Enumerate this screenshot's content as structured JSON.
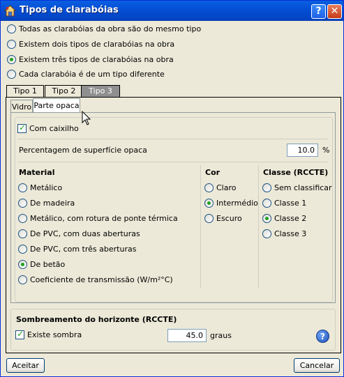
{
  "window": {
    "title": "Tipos de clarabóias",
    "help_btn": "?",
    "close_btn": "✕"
  },
  "type_options": [
    {
      "label": "Todas as clarabóias da obra são do mesmo tipo",
      "checked": false
    },
    {
      "label": "Existem dois tipos de clarabóias na obra",
      "checked": false
    },
    {
      "label": "Existem três tipos de clarabóias na obra",
      "checked": true
    },
    {
      "label": "Cada clarabóia é de um tipo diferente",
      "checked": false
    }
  ],
  "tabs": [
    {
      "label": "Tipo 1",
      "active": false
    },
    {
      "label": "Tipo 2",
      "active": false
    },
    {
      "label": "Tipo 3",
      "active": true
    }
  ],
  "subtabs": [
    {
      "label": "Vidro",
      "active": false
    },
    {
      "label": "Parte opaca",
      "active": true
    }
  ],
  "opaque": {
    "frame_label": "Com caixilho",
    "frame_checked": true,
    "percent_label": "Percentagem de superfície opaca",
    "percent_value": "10.0",
    "percent_unit": "%"
  },
  "material": {
    "header": "Material",
    "options": [
      {
        "label": "Metálico",
        "checked": false
      },
      {
        "label": "De madeira",
        "checked": false
      },
      {
        "label": "Metálico, com rotura de ponte térmica",
        "checked": false
      },
      {
        "label": "De PVC, com duas aberturas",
        "checked": false
      },
      {
        "label": "De PVC, com três aberturas",
        "checked": false
      },
      {
        "label": "De betão",
        "checked": true
      },
      {
        "label": "Coeficiente de transmissão (W/m²°C)",
        "checked": false
      }
    ]
  },
  "cor": {
    "header": "Cor",
    "options": [
      {
        "label": "Claro",
        "checked": false
      },
      {
        "label": "Intermédio",
        "checked": true
      },
      {
        "label": "Escuro",
        "checked": false
      }
    ]
  },
  "classe": {
    "header": "Classe (RCCTE)",
    "options": [
      {
        "label": "Sem classificar",
        "checked": false
      },
      {
        "label": "Classe 1",
        "checked": false
      },
      {
        "label": "Classe 2",
        "checked": true
      },
      {
        "label": "Classe 3",
        "checked": false
      }
    ]
  },
  "shading": {
    "header": "Sombreamento do horizonte (RCCTE)",
    "check_label": "Existe sombra",
    "checked": true,
    "value": "45.0",
    "unit": "graus",
    "help": "?"
  },
  "buttons": {
    "accept": "Aceitar",
    "cancel": "Cancelar"
  }
}
